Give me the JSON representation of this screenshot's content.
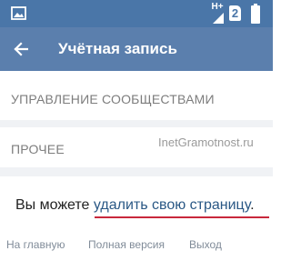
{
  "status_bar": {
    "network": "H+",
    "sim": "2",
    "icons": [
      "gallery-icon",
      "signal-icon",
      "battery-icon"
    ],
    "background": "#4a76a8"
  },
  "header": {
    "title": "Учётная запись",
    "back_icon": "arrow-left-icon",
    "background": "#5b7fad"
  },
  "menu": {
    "items": [
      {
        "label": "УПРАВЛЕНИЕ СООБЩЕСТВАМИ"
      },
      {
        "label": "ПРОЧЕЕ"
      }
    ]
  },
  "watermark": "InetGramotnost.ru",
  "delete_account": {
    "prefix": "Вы можете",
    "link": "удалить свою страницу",
    "suffix": ".",
    "link_color": "#2a5885",
    "underline_color": "#c8283c"
  },
  "footer": {
    "home": "На главную",
    "full_version": "Полная версия",
    "logout": "Выход"
  }
}
